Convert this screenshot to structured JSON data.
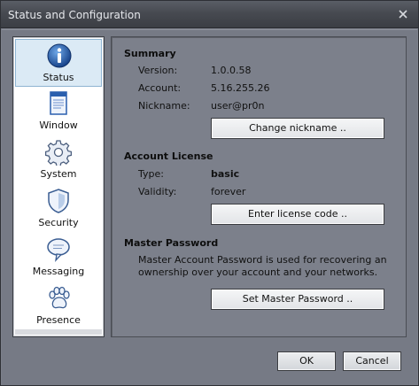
{
  "window": {
    "title": "Status and Configuration"
  },
  "sidebar": {
    "items": [
      {
        "label": "Status",
        "icon": "info-icon",
        "selected": true
      },
      {
        "label": "Window",
        "icon": "window-icon",
        "selected": false
      },
      {
        "label": "System",
        "icon": "gear-icon",
        "selected": false
      },
      {
        "label": "Security",
        "icon": "shield-icon",
        "selected": false
      },
      {
        "label": "Messaging",
        "icon": "speech-bubble-icon",
        "selected": false
      },
      {
        "label": "Presence",
        "icon": "paw-icon",
        "selected": false
      }
    ]
  },
  "summary": {
    "title": "Summary",
    "version_label": "Version:",
    "version_value": "1.0.0.58",
    "account_label": "Account:",
    "account_value": "5.16.255.26",
    "nickname_label": "Nickname:",
    "nickname_value": "user@pr0n",
    "change_nickname_button": "Change nickname .."
  },
  "license": {
    "title": "Account License",
    "type_label": "Type:",
    "type_value": "basic",
    "validity_label": "Validity:",
    "validity_value": "forever",
    "enter_code_button": "Enter license code .."
  },
  "master_password": {
    "title": "Master Password",
    "description": "Master Account Password is used for recovering an ownership over your account and your networks.",
    "set_button": "Set Master Password .."
  },
  "footer": {
    "ok_label": "OK",
    "cancel_label": "Cancel"
  },
  "colors": {
    "accent": "#1f5fa8",
    "panel": "#7c808b",
    "titlebar": "#474a51"
  }
}
